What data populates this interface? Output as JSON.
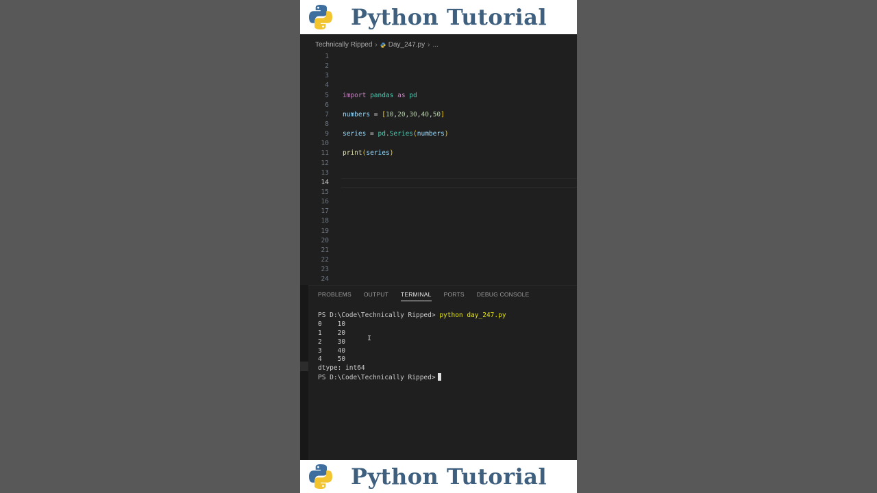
{
  "banner": {
    "title": "Python Tutorial",
    "icon": "python-logo-icon",
    "colors": {
      "blue": "#3e6e9e",
      "yellow": "#f2c430",
      "title": "#3e5f7e"
    }
  },
  "breadcrumb": {
    "folder": "Technically Ripped",
    "file": "Day_247.py",
    "ellipsis": "..."
  },
  "editor": {
    "active_line": "14",
    "lines": [
      {
        "n": "1"
      },
      {
        "n": "2"
      },
      {
        "n": "3"
      },
      {
        "n": "4"
      },
      {
        "n": "5",
        "tokens": [
          {
            "t": "import",
            "c": "kw"
          },
          {
            "t": " "
          },
          {
            "t": "pandas",
            "c": "mod"
          },
          {
            "t": " "
          },
          {
            "t": "as",
            "c": "kw"
          },
          {
            "t": " "
          },
          {
            "t": "pd",
            "c": "mod"
          }
        ]
      },
      {
        "n": "6"
      },
      {
        "n": "7",
        "tokens": [
          {
            "t": "numbers",
            "c": "var"
          },
          {
            "t": " = ",
            "c": "op"
          },
          {
            "t": "[",
            "c": "br"
          },
          {
            "t": "10",
            "c": "num"
          },
          {
            "t": ",",
            "c": "op"
          },
          {
            "t": "20",
            "c": "num"
          },
          {
            "t": ",",
            "c": "op"
          },
          {
            "t": "30",
            "c": "num"
          },
          {
            "t": ",",
            "c": "op"
          },
          {
            "t": "40",
            "c": "num"
          },
          {
            "t": ",",
            "c": "op"
          },
          {
            "t": "50",
            "c": "num"
          },
          {
            "t": "]",
            "c": "br"
          }
        ]
      },
      {
        "n": "8"
      },
      {
        "n": "9",
        "tokens": [
          {
            "t": "series",
            "c": "var"
          },
          {
            "t": " = ",
            "c": "op"
          },
          {
            "t": "pd",
            "c": "mod"
          },
          {
            "t": ".",
            "c": "op"
          },
          {
            "t": "Series",
            "c": "mod"
          },
          {
            "t": "(",
            "c": "br"
          },
          {
            "t": "numbers",
            "c": "var"
          },
          {
            "t": ")",
            "c": "br"
          }
        ]
      },
      {
        "n": "10"
      },
      {
        "n": "11",
        "tokens": [
          {
            "t": "print",
            "c": "fn"
          },
          {
            "t": "(",
            "c": "br"
          },
          {
            "t": "series",
            "c": "var"
          },
          {
            "t": ")",
            "c": "br"
          }
        ]
      },
      {
        "n": "12"
      },
      {
        "n": "13"
      },
      {
        "n": "14"
      },
      {
        "n": "15"
      },
      {
        "n": "16"
      },
      {
        "n": "17"
      },
      {
        "n": "18"
      },
      {
        "n": "19"
      },
      {
        "n": "20"
      },
      {
        "n": "21"
      },
      {
        "n": "22"
      },
      {
        "n": "23"
      },
      {
        "n": "24"
      }
    ]
  },
  "panel": {
    "tabs": [
      {
        "label": "PROBLEMS",
        "name": "tab-problems",
        "active": false
      },
      {
        "label": "OUTPUT",
        "name": "tab-output",
        "active": false
      },
      {
        "label": "TERMINAL",
        "name": "tab-terminal",
        "active": true
      },
      {
        "label": "PORTS",
        "name": "tab-ports",
        "active": false
      },
      {
        "label": "DEBUG CONSOLE",
        "name": "tab-debug-console",
        "active": false
      }
    ]
  },
  "terminal": {
    "prompt": "PS D:\\Code\\Technically Ripped>",
    "command": "python day_247.py",
    "output": [
      "0    10",
      "1    20",
      "2    30",
      "3    40",
      "4    50",
      "dtype: int64"
    ]
  }
}
